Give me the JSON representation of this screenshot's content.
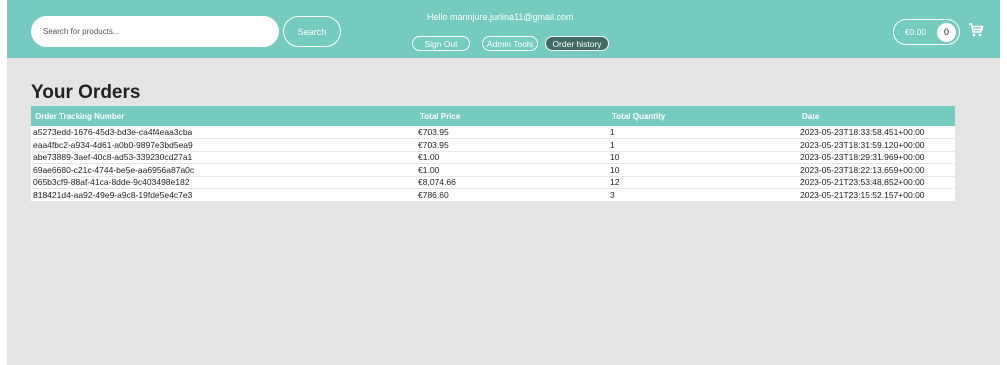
{
  "header": {
    "search_placeholder": "Search for products...",
    "search_label": "Search",
    "greeting": "Hello marinjure.jurlina11@gmail.com",
    "nav": {
      "sign_out": "Sign Out",
      "admin_tools": "Admin Tools",
      "order_history": "Order history"
    },
    "cart": {
      "total": "€0.00",
      "count": "0",
      "icon": "shopping-cart-icon"
    },
    "colors": {
      "bar": "#75cbbf",
      "active_nav": "#3f6b64"
    }
  },
  "main": {
    "title": "Your Orders",
    "columns": [
      "Order Tracking Number",
      "Total Price",
      "Total Quantity",
      "Date"
    ],
    "rows": [
      [
        "a5273edd-1676-45d3-bd3e-ca4f4eaa3cba",
        "€703.95",
        "1",
        "2023-05-23T18:33:58.451+00:00"
      ],
      [
        "eaa4fbc2-a934-4d61-a0b0-9897e3bd5ea9",
        "€703.95",
        "1",
        "2023-05-23T18:31:59.120+00:00"
      ],
      [
        "abe73889-3aef-40c8-ad53-339230cd27a1",
        "€1.00",
        "10",
        "2023-05-23T18:29:31.969+00:00"
      ],
      [
        "69ae6680-c21c-4744-be5e-aa6956a87a0c",
        "€1.00",
        "10",
        "2023-05-23T18:22:13.659+00:00"
      ],
      [
        "065b3cf9-88af-41ca-8dde-9c403498e182",
        "€8,074.66",
        "12",
        "2023-05-21T23:53:48.852+00:00"
      ],
      [
        "818421d4-aa92-49e9-a9c8-19fde5e4c7e3",
        "€786.60",
        "3",
        "2023-05-21T23:15:52.157+00:00"
      ]
    ]
  }
}
